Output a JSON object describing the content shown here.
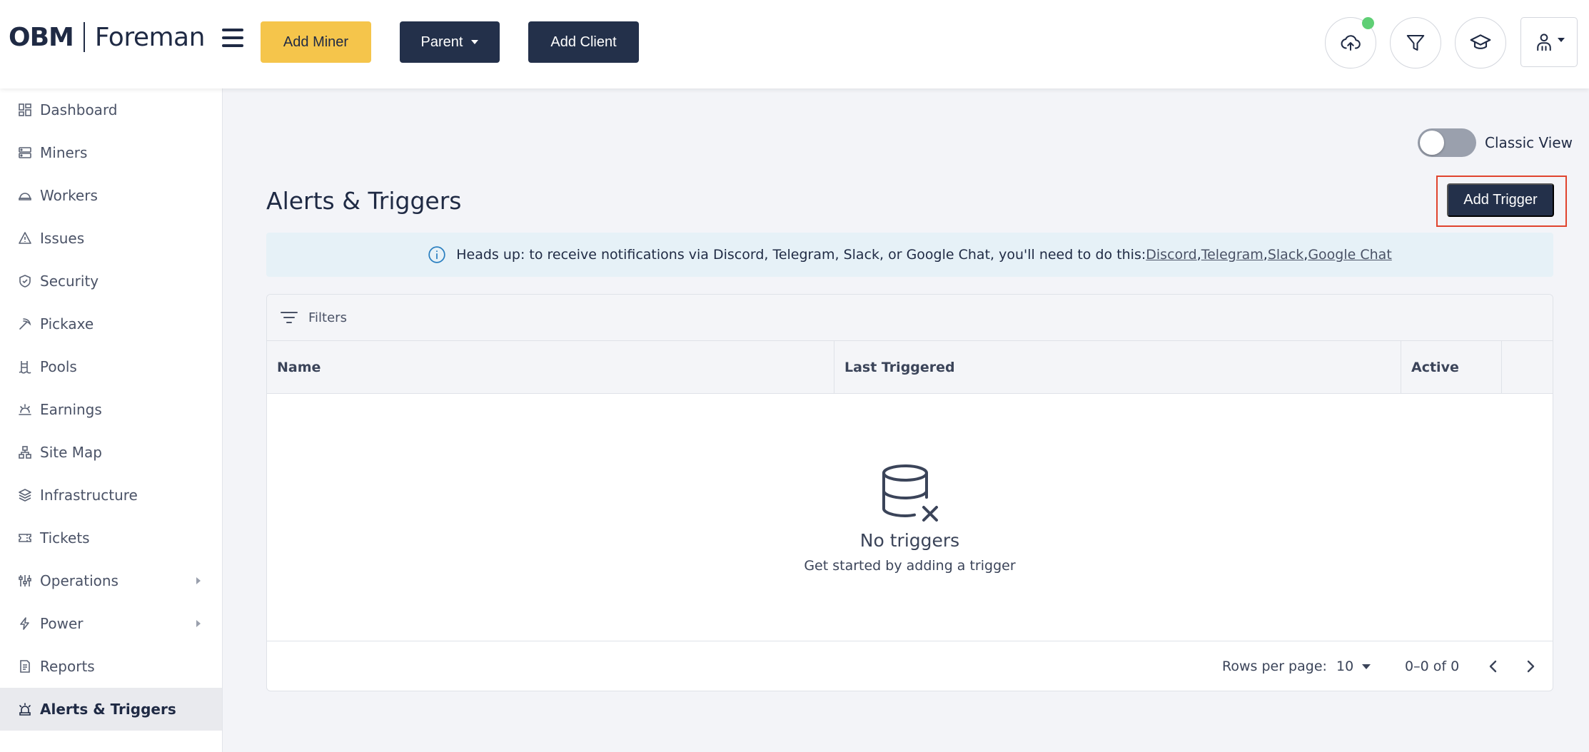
{
  "header": {
    "logo_left": "OBM",
    "logo_right": "Foreman",
    "add_miner": "Add Miner",
    "parent": "Parent",
    "add_client": "Add Client"
  },
  "sidebar": {
    "items": [
      {
        "label": "Dashboard",
        "icon": "dashboard-icon"
      },
      {
        "label": "Miners",
        "icon": "server-icon"
      },
      {
        "label": "Workers",
        "icon": "helmet-icon"
      },
      {
        "label": "Issues",
        "icon": "warning-icon"
      },
      {
        "label": "Security",
        "icon": "shield-icon"
      },
      {
        "label": "Pickaxe",
        "icon": "pickaxe-icon"
      },
      {
        "label": "Pools",
        "icon": "pools-icon"
      },
      {
        "label": "Earnings",
        "icon": "earnings-icon"
      },
      {
        "label": "Site Map",
        "icon": "sitemap-icon"
      },
      {
        "label": "Infrastructure",
        "icon": "layers-icon"
      },
      {
        "label": "Tickets",
        "icon": "ticket-icon"
      },
      {
        "label": "Operations",
        "icon": "sliders-icon"
      },
      {
        "label": "Power",
        "icon": "bolt-icon"
      },
      {
        "label": "Reports",
        "icon": "report-icon"
      },
      {
        "label": "Alerts & Triggers",
        "icon": "alarm-icon"
      }
    ]
  },
  "main": {
    "toggle_label": "Classic View",
    "title": "Alerts & Triggers",
    "add_trigger": "Add Trigger",
    "banner": {
      "text": "Heads up: to receive notifications via Discord, Telegram, Slack, or Google Chat, you'll need to do this: ",
      "links": [
        "Discord",
        "Telegram",
        "Slack",
        "Google Chat"
      ],
      "sep": ", "
    },
    "filters": "Filters",
    "columns": [
      "Name",
      "Last Triggered",
      "Active"
    ],
    "empty_title": "No triggers",
    "empty_sub": "Get started by adding a trigger",
    "footer": {
      "rows_label": "Rows per page:",
      "rows_value": "10",
      "range": "0–0 of 0"
    }
  },
  "colors": {
    "accent_yellow": "#f5c54b",
    "navy": "#23304a",
    "online_dot": "#5fcf75",
    "highlight_outline": "#e0442e"
  }
}
